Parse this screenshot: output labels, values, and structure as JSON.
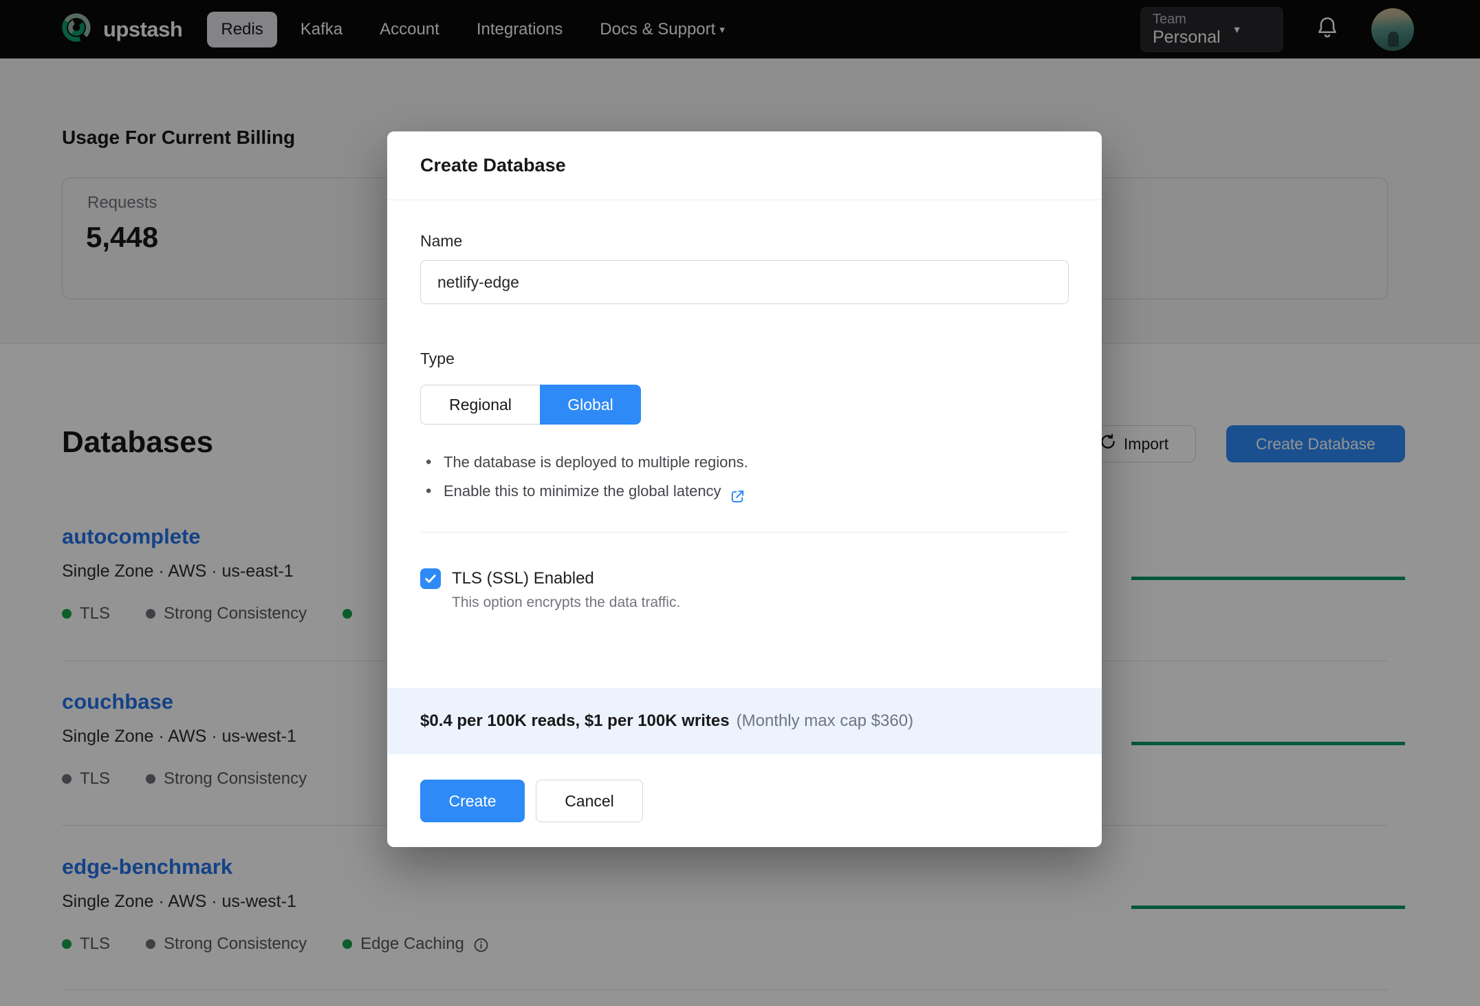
{
  "colors": {
    "accent_blue": "#2e8af6",
    "link_blue": "#2472e8",
    "sparkline_green": "#05976a",
    "dot_green": "#16a34a",
    "dot_gray": "#6f6f78",
    "banner_bg": "#ecf3fc",
    "nav_bg": "#0a0a0a",
    "logo_green": "#0d9f6e",
    "logo_sage": "#94b8a5"
  },
  "nav": {
    "brand": "upstash",
    "items": [
      "Redis",
      "Kafka",
      "Account",
      "Integrations",
      "Docs & Support"
    ],
    "active_item": "Redis",
    "team_label": "Team",
    "team_value": "Personal"
  },
  "usage": {
    "title": "Usage For Current Billing",
    "requests_label": "Requests",
    "requests_value": "5,448"
  },
  "databases": {
    "title": "Databases",
    "import_label": "Import",
    "create_label": "Create Database",
    "rows": [
      {
        "name": "autocomplete",
        "meta": "Single Zone · AWS · us-east-1",
        "badges": [
          {
            "label": "TLS",
            "dot": "green"
          },
          {
            "label": "Strong Consistency",
            "dot": "gray"
          },
          {
            "label": "",
            "dot": "green"
          }
        ]
      },
      {
        "name": "couchbase",
        "meta": "Single Zone · AWS · us-west-1",
        "badges": [
          {
            "label": "TLS",
            "dot": "gray"
          },
          {
            "label": "Strong Consistency",
            "dot": "gray"
          }
        ]
      },
      {
        "name": "edge-benchmark",
        "meta": "Single Zone · AWS · us-west-1",
        "badges": [
          {
            "label": "TLS",
            "dot": "green"
          },
          {
            "label": "Strong Consistency",
            "dot": "gray"
          },
          {
            "label": "Edge Caching",
            "dot": "green"
          }
        ]
      }
    ]
  },
  "modal": {
    "title": "Create Database",
    "name_label": "Name",
    "name_value": "netlify-edge",
    "type_label": "Type",
    "regional_label": "Regional",
    "global_label": "Global",
    "selected_type": "Global",
    "bullet_1": "The database is deployed to multiple regions.",
    "bullet_2": "Enable this to minimize the global latency",
    "tls_label": "TLS (SSL) Enabled",
    "tls_desc": "This option encrypts the data traffic.",
    "tls_checked": true,
    "pricing_bold": "$0.4 per 100K reads, $1 per 100K writes",
    "pricing_note": "(Monthly max cap $360)",
    "create_label": "Create",
    "cancel_label": "Cancel"
  }
}
